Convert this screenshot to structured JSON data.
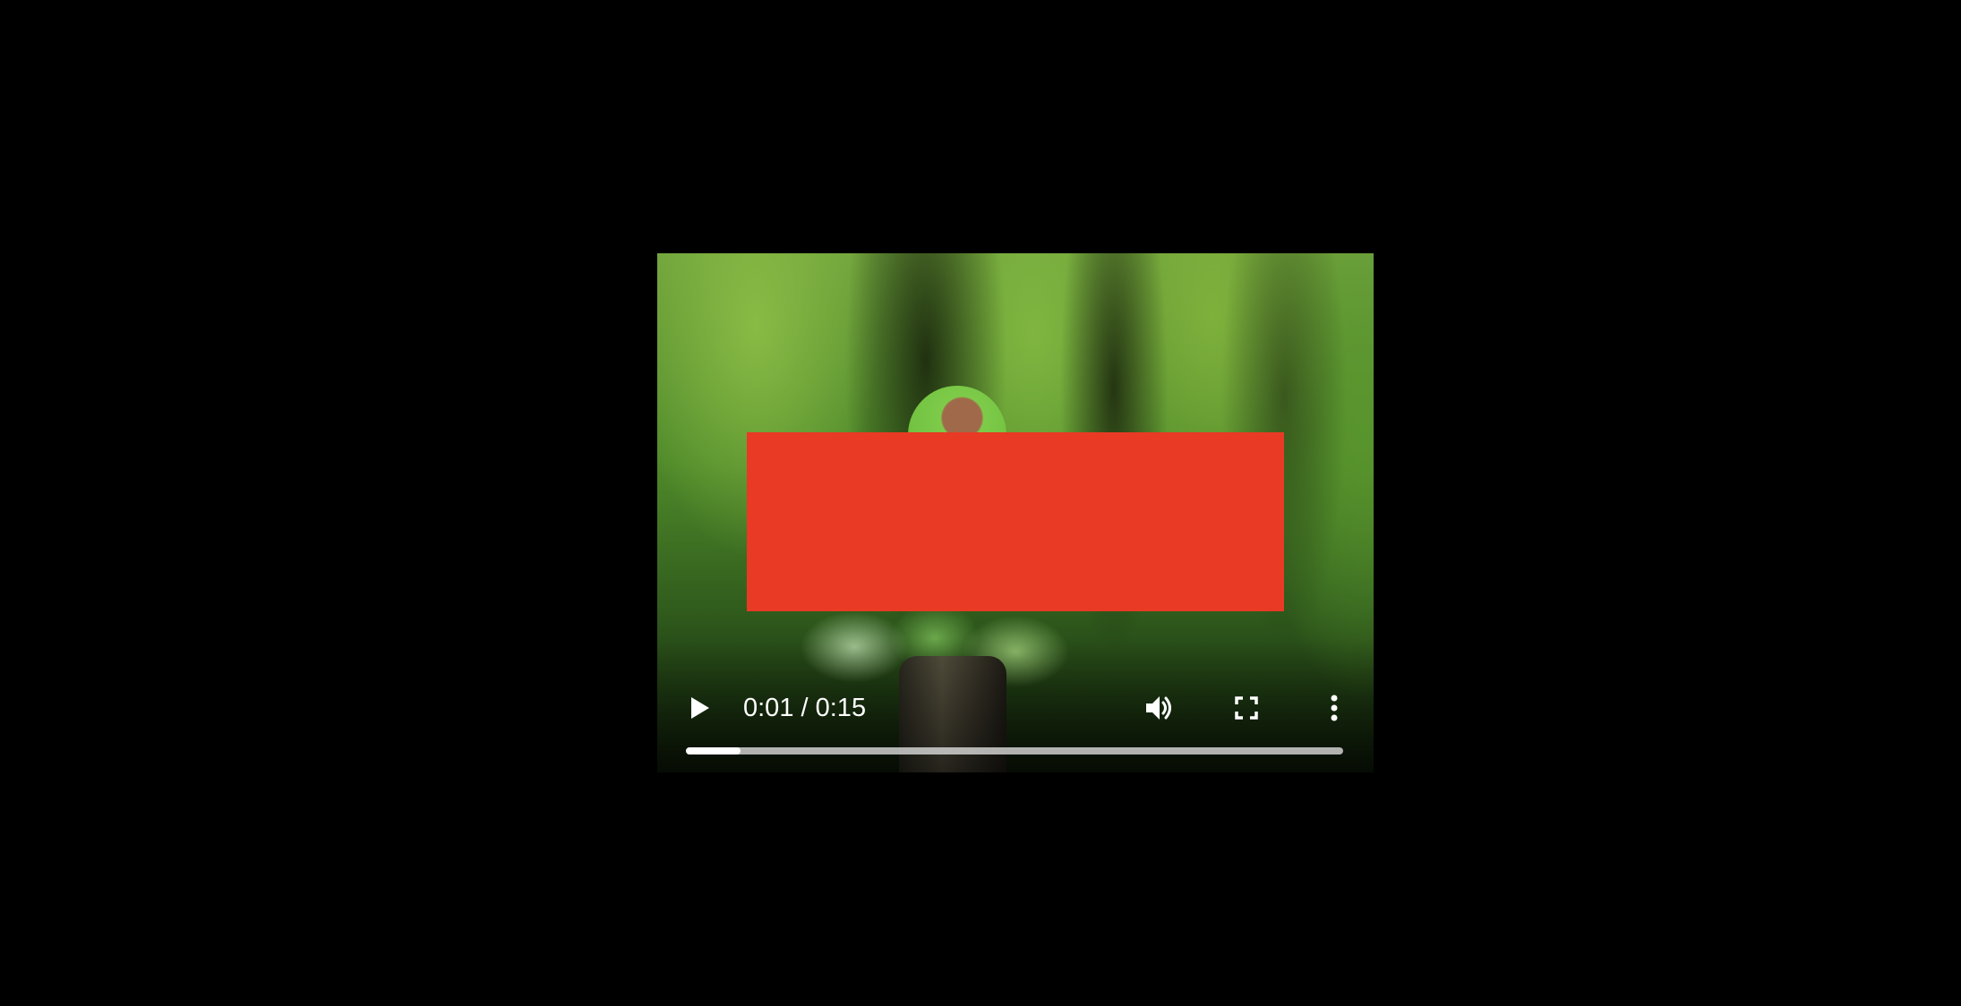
{
  "player": {
    "current_time": "0:01",
    "separator": " / ",
    "duration": "0:15",
    "progress_fraction": 0.083,
    "icons": {
      "play": "play-icon",
      "volume": "volume-icon",
      "fullscreen": "fullscreen-icon",
      "more": "more-options-icon"
    },
    "colors": {
      "background": "#000000",
      "redaction": "#e83a24",
      "progress_fill": "#ffffff"
    }
  }
}
